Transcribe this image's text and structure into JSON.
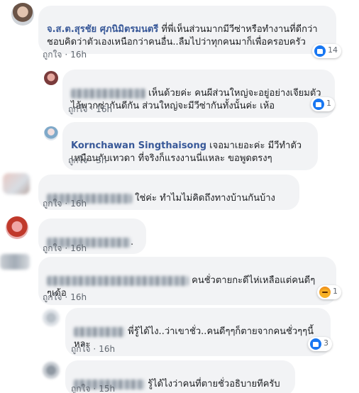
{
  "comments": [
    {
      "author": "จ.ส.ต.สุรชัย ศุภนิมิตรมนตรี",
      "text": " ที่พี่เห็นส่วนมากมีวีซ่าหรือทำงานที่ดีกว่าชอบคิดว่าตัวเองเหนือกว่าคนอื่น..ลืมไปว่าทุกคนมาก็เพื่อครอบครัว",
      "like": "ถูกใจ",
      "time": "16h",
      "reactions": "14"
    },
    {
      "author": "",
      "text": "เห็นด้วยค่ะ คนผีส่วนใหญ่จะอยู่อย่างเจียมตัว ไอ้พวกซ่ากันดีกัน ส่วนใหญ่จะมีวีซ่ากันทั้งนั้นค่ะ เห้อ",
      "like": "ถูกใจ",
      "time": "16h",
      "reactions": "1"
    },
    {
      "author": "Kornchawan Singthaisong",
      "text": " เจอมาเยอะค่ะ มีวีทำตัวเหมือนกับเทวดา ที่จริงก็แรงงานนี่แหละ ขอพูดตรงๆ",
      "like": "ถูกใจ",
      "time": "3h"
    },
    {
      "text": "ใช่ค่ะ ทำไมไม่คิดถึงทางบ้านกันบ้าง",
      "like": "ถูกใจ",
      "time": "16h"
    },
    {
      "text": ".",
      "like": "ถูกใจ",
      "time": "16h"
    },
    {
      "text": "คนชั่วตายกะดีไห่เหลือแต่คนดีๆๆเด้อ",
      "like": "ถูกใจ",
      "time": "16h",
      "reactions": "1"
    },
    {
      "text": "พี่รู้ได้ไง..ว่าเขาชั่ว..คนดีๆๆก็ตายจากคนชั่วๆๆนี้หละ",
      "like": "ถูกใจ",
      "time": "16h",
      "reactions": "3"
    },
    {
      "text": "รู้ได้ไงว่าคนที่ตายชั่วอธิบายทีครับ",
      "like": "ถูกใจ",
      "time": "15h"
    }
  ],
  "colors": {
    "bubble": "#f2f3f5",
    "author": "#385898",
    "meta": "#606770",
    "like_blue": "#1877f2"
  },
  "icons": [
    "like-icon",
    "angry-icon"
  ]
}
